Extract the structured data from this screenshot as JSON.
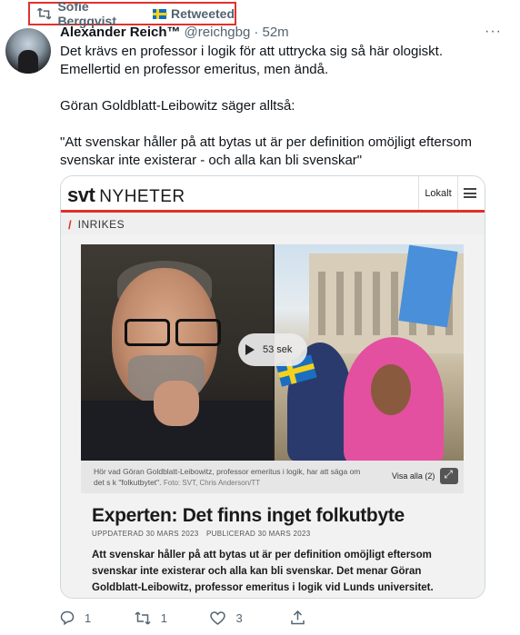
{
  "retweet": {
    "name": "Sofie Bergqvist",
    "label": "Retweeted"
  },
  "author": {
    "display_name": "Alexander Reich™",
    "handle": "@reichgbg",
    "time": "· 52m",
    "more": "···"
  },
  "tweet": {
    "line1": "Det krävs en professor i logik för att uttrycka sig så här ologiskt.",
    "line2": "Emellertid en professor emeritus, men ändå.",
    "line3": "Göran Goldblatt-Leibowitz säger alltså:",
    "line4": "\"Att svenskar håller på att bytas ut är per definition omöjligt eftersom svenskar inte existerar - och alla kan bli svenskar\""
  },
  "card": {
    "logo_svt": "svt",
    "logo_nyheter": "NYHETER",
    "lokalt": "Lokalt",
    "section": "INRIKES",
    "play_duration": "53 sek",
    "caption": "Hör vad Göran Goldblatt-Leibowitz, professor emeritus i logik, har att säga om det s k \"folkutbytet\".",
    "credit": "Foto: SVT, Chris Anderson/TT",
    "visa_alla": "Visa alla (2)",
    "headline": "Experten: Det finns inget folkutbyte",
    "updated": "UPPDATERAD 30 MARS 2023",
    "published": "PUBLICERAD 30 MARS 2023",
    "lead": "Att svenskar håller på att bytas ut är per definition omöjligt eftersom svenskar inte existerar och alla kan bli svenskar. Det menar Göran Goldblatt-Leibowitz, professor emeritus i logik vid Lunds universitet."
  },
  "actions": {
    "replies": "1",
    "retweets": "1",
    "likes": "3"
  }
}
